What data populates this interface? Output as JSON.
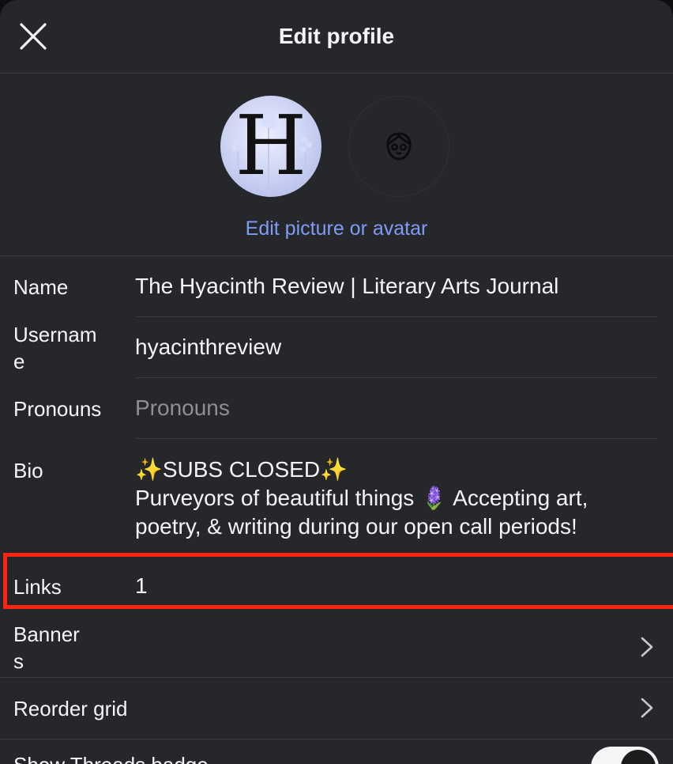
{
  "header": {
    "title": "Edit profile",
    "close_icon": "close-icon"
  },
  "avatar": {
    "photo_letter": "H",
    "alt_icon": "avatar-face-icon",
    "edit_link": "Edit picture or avatar"
  },
  "fields": {
    "name": {
      "label": "Name",
      "value": "The Hyacinth Review | Literary Arts Journal"
    },
    "username": {
      "label_line1": "Usernam",
      "label_line2": "e",
      "value": "hyacinthreview"
    },
    "pronouns": {
      "label": "Pronouns",
      "placeholder": "Pronouns"
    },
    "bio": {
      "label": "Bio",
      "line1": "✨SUBS CLOSED✨",
      "line2": "Purveyors of beautiful things 🪻 Accepting art,",
      "line3": "poetry, & writing during our open call periods!"
    },
    "links": {
      "label": "Links",
      "value": "1"
    },
    "banners": {
      "label_line1": "Banner",
      "label_line2": "s",
      "icon": "chevron-right-icon"
    },
    "reorder": {
      "label": "Reorder grid",
      "icon": "chevron-right-icon"
    },
    "show_threads": {
      "label": "Show Threads badge",
      "toggle_on": true
    }
  },
  "colors": {
    "background": "#26272b",
    "accent_link": "#7f9cf5",
    "highlight": "#ff2311"
  }
}
